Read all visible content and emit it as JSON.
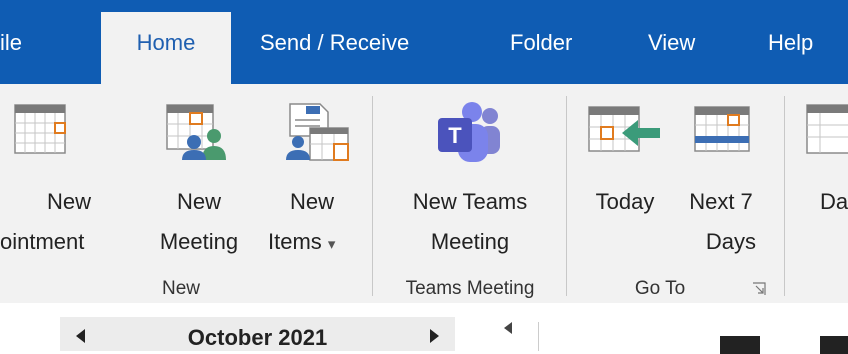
{
  "tabs": [
    {
      "label": "ile",
      "active": false
    },
    {
      "label": "Home",
      "active": true
    },
    {
      "label": "Send / Receive",
      "active": false
    },
    {
      "label": "Folder",
      "active": false
    },
    {
      "label": "View",
      "active": false
    },
    {
      "label": "Help",
      "active": false
    }
  ],
  "ribbon": {
    "new_group": {
      "label": "New",
      "new_appointment": {
        "line1": "New",
        "line2": "ointment"
      },
      "new_meeting": {
        "line1": "New",
        "line2": "Meeting"
      },
      "new_items": {
        "line1": "New",
        "line2": "Items",
        "dropdown": "▾"
      }
    },
    "teams_group": {
      "label": "Teams Meeting",
      "new_teams_meeting": {
        "line1": "New Teams",
        "line2": "Meeting"
      }
    },
    "goto_group": {
      "label": "Go To",
      "today": {
        "line1": "Today"
      },
      "next7": {
        "line1": "Next 7",
        "line2": "Days"
      }
    },
    "arrange_group": {
      "day": {
        "line1": "Da"
      }
    }
  },
  "calendar": {
    "month_label": "October 2021"
  },
  "colors": {
    "accent": "#0f5cb3",
    "ribbon_bg": "#f2f2f2",
    "teams_purple": "#5b5fc7",
    "people_green": "#4a9a6e",
    "people_blue": "#3c6eb4",
    "arrow_green": "#3b9b7a"
  }
}
